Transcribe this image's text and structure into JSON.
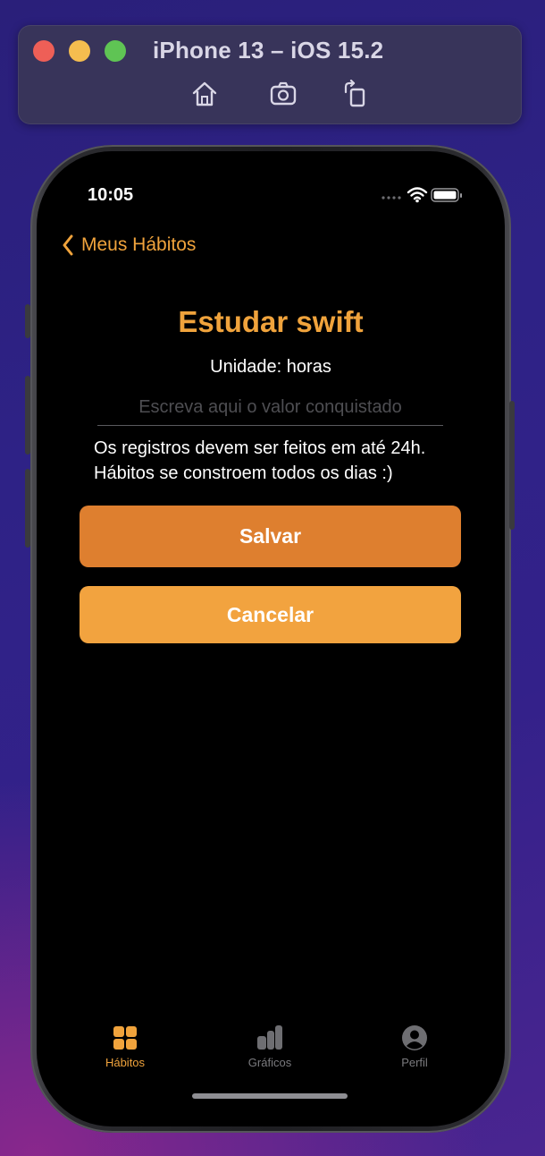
{
  "simulator": {
    "title": "iPhone 13 – iOS 15.2",
    "tools": [
      "home-icon",
      "screenshot-icon",
      "rotate-icon"
    ]
  },
  "status_bar": {
    "time": "10:05"
  },
  "nav": {
    "back_label": "Meus Hábitos"
  },
  "habit": {
    "title": "Estudar swift",
    "unit_text": "Unidade: horas",
    "input_value": "",
    "input_placeholder": "Escreva aqui o valor conquistado",
    "note_line1": "Os registros devem ser feitos em até 24h.",
    "note_line2": "Hábitos se constroem todos os dias :)"
  },
  "buttons": {
    "save": "Salvar",
    "cancel": "Cancelar"
  },
  "tabbar": {
    "tabs": [
      {
        "label": "Hábitos",
        "icon": "grid-icon",
        "active": true
      },
      {
        "label": "Gráficos",
        "icon": "bar-chart-icon",
        "active": false
      },
      {
        "label": "Perfil",
        "icon": "person-icon",
        "active": false
      }
    ]
  },
  "colors": {
    "accent": "#f0a33c",
    "save_button": "#de7f2f",
    "cancel_button": "#f2a33f",
    "screen_bg": "#000000"
  }
}
